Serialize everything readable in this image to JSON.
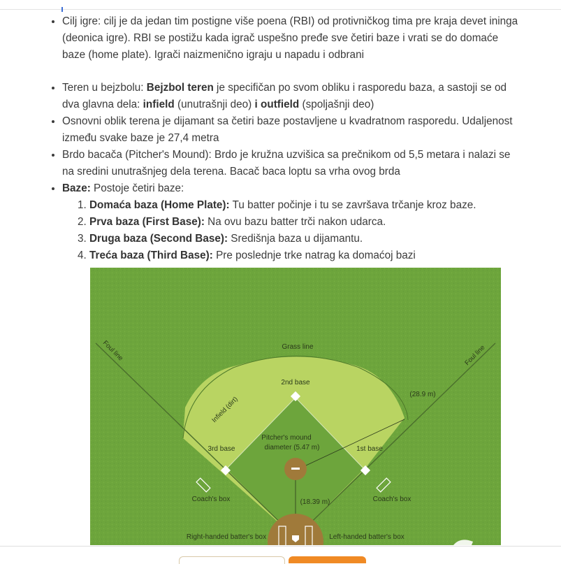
{
  "bullets_intro": [
    {
      "text": "Cilj igre: cilj je da jedan tim postigne više poena (RBI) od protivničkog tima pre kraja devet ininga (deonica igre). RBI se postižu kada igrač uspešno pređe sve četiri baze i vrati se do domaće baze (home plate). Igrači naizmenično igraju u napadu i odbrani"
    }
  ],
  "terrain": {
    "prefix": "Teren u bejzbolu: ",
    "bold1": "Bejzbol teren",
    "middle1": " je specifičan po svom obliku i rasporedu baza, a sastoji se od dva glavna dela: ",
    "bold2": "infield",
    "middle2": " (unutrašnji deo) ",
    "bold3": "i outfield",
    "suffix": " (spoljašnji deo)"
  },
  "shape": {
    "text": "Osnovni oblik terena je dijamant sa četiri baze postavljene u kvadratnom rasporedu. Udaljenost između svake baze je 27,4 metra"
  },
  "mound": {
    "text": "Brdo bacača (Pitcher's Mound): Brdo je kružna uzvišica sa prečnikom od 5,5 metara i nalazi se na sredini unutrašnjeg dela terena. Bacač baca loptu sa vrha ovog brda"
  },
  "bases": {
    "label": "Baze:",
    "intro": " Postoje četiri baze:",
    "items": [
      {
        "name": "Domaća baza (Home Plate):",
        "desc": " Tu batter počinje i tu se završava trčanje kroz baze."
      },
      {
        "name": "Prva baza (First Base):",
        "desc": " Na ovu bazu batter trči nakon udarca."
      },
      {
        "name": "Druga baza (Second Base):",
        "desc": " Središnja baza u dijamantu."
      },
      {
        "name": "Treća baza (Third Base):",
        "desc": " Pre poslednje trke natrag ka domaćoj bazi"
      }
    ]
  },
  "diagram": {
    "grass_line": "Grass line",
    "foul_line_left": "Foul line",
    "foul_line_right": "Foul line",
    "second_base": "2nd base",
    "first_base": "1st base",
    "third_base": "3rd base",
    "infield_dirt": "Infield (dirt)",
    "pitchers_mound": "Pitcher's mound",
    "mound_diameter": "diameter (5.47 m)",
    "dist_outfield": "(28.9 m)",
    "dist_mound": "(18.39 m)",
    "coach_box_left": "Coach's box",
    "coach_box_right": "Coach's box",
    "rh_batter_box": "Right-handed batter's box",
    "lh_batter_box": "Left-handed batter's box",
    "colors": {
      "grass": "#6da53c",
      "infield": "#b9d462",
      "lines": "#ffffff",
      "mound": "#a07a3a"
    }
  }
}
